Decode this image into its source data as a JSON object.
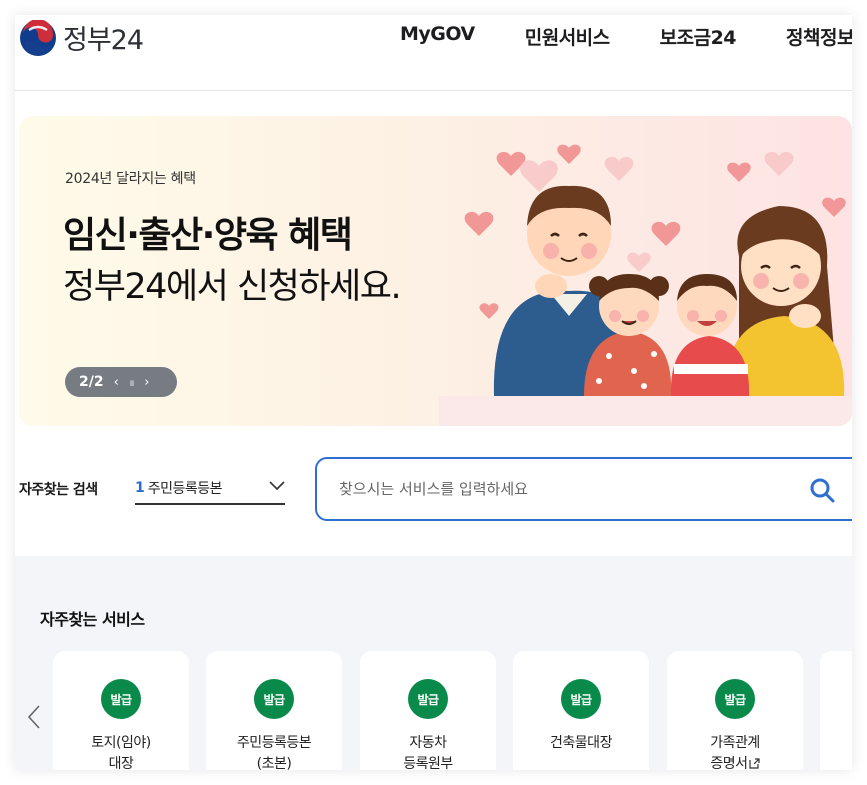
{
  "brand": {
    "name": "정부24",
    "colors": {
      "red": "#cd2e3a",
      "blue": "#0f3c8c",
      "green": "#0a8a4a",
      "accent_blue": "#2f6fd0"
    }
  },
  "nav": {
    "items": [
      "MyGOV",
      "민원서비스",
      "보조금24",
      "정책정보"
    ]
  },
  "banner": {
    "eyebrow": "2024년 달라지는 혜택",
    "title": "임신·출산·양육 혜택",
    "subtitle": "정부24에서 신청하세요.",
    "pager": {
      "current": "2/2",
      "prev_icon": "‹",
      "pause_icon": "॥",
      "next_icon": "›"
    }
  },
  "search": {
    "quick_label": "자주찾는 검색",
    "quick_select": {
      "rank": "1",
      "value": "주민등록등본"
    },
    "placeholder": "찾으시는 서비스를 입력하세요"
  },
  "services": {
    "title": "자주찾는 서비스",
    "items": [
      {
        "badge": "발급",
        "label": "토지(임야)\n대장"
      },
      {
        "badge": "발급",
        "label": "주민등록등본\n(초본)"
      },
      {
        "badge": "발급",
        "label": "자동차\n등록원부"
      },
      {
        "badge": "발급",
        "label": "건축물대장"
      },
      {
        "badge": "발급",
        "label": "가족관계\n증명서"
      }
    ]
  }
}
